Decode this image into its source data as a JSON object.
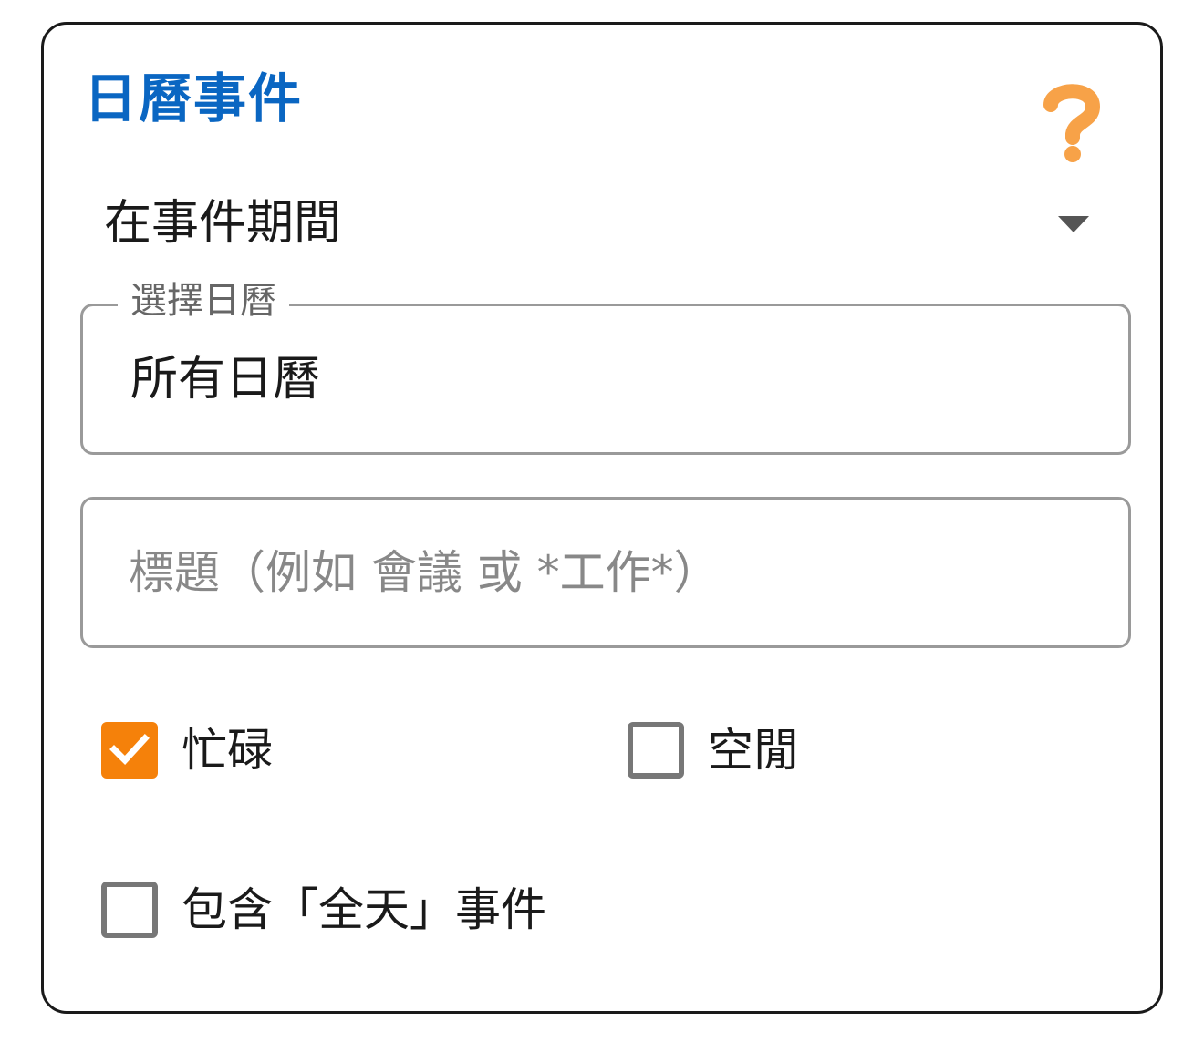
{
  "panel": {
    "title": "日曆事件",
    "help_icon": "question-mark-icon",
    "help_color": "#f7a248",
    "title_color": "#0a66c2"
  },
  "timing_dropdown": {
    "selected": "在事件期間",
    "icon": "caret-down-icon"
  },
  "calendar_field": {
    "label": "選擇日曆",
    "value": "所有日曆"
  },
  "title_field": {
    "value": "",
    "placeholder": "標題（例如 會議 或 *工作*）"
  },
  "options": {
    "busy": {
      "label": "忙碌",
      "checked": true,
      "check_color": "#f5810a"
    },
    "free": {
      "label": "空閒",
      "checked": false
    },
    "all_day": {
      "label": "包含「全天」事件",
      "checked": false
    }
  }
}
